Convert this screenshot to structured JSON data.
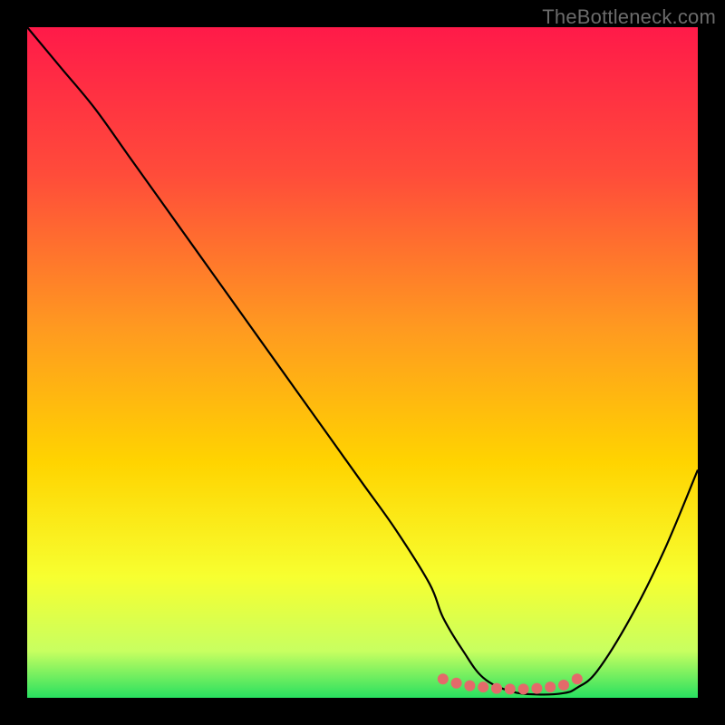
{
  "watermark": "TheBottleneck.com",
  "chart_data": {
    "type": "line",
    "title": "",
    "xlabel": "",
    "ylabel": "",
    "xlim": [
      0,
      100
    ],
    "ylim": [
      0,
      100
    ],
    "background_gradient": {
      "stops": [
        {
          "offset": 0.0,
          "color": "#ff1a49"
        },
        {
          "offset": 0.22,
          "color": "#ff4c3a"
        },
        {
          "offset": 0.45,
          "color": "#ff9a20"
        },
        {
          "offset": 0.65,
          "color": "#ffd400"
        },
        {
          "offset": 0.82,
          "color": "#f7ff30"
        },
        {
          "offset": 0.93,
          "color": "#c8ff60"
        },
        {
          "offset": 1.0,
          "color": "#28e060"
        }
      ]
    },
    "series": [
      {
        "name": "bottleneck-curve",
        "color": "#000000",
        "x": [
          0,
          5,
          10,
          15,
          20,
          25,
          30,
          35,
          40,
          45,
          50,
          55,
          60,
          62,
          65,
          68,
          72,
          76,
          80,
          82,
          85,
          90,
          95,
          100
        ],
        "values": [
          100,
          94,
          88,
          81,
          74,
          67,
          60,
          53,
          46,
          39,
          32,
          25,
          17,
          12,
          7,
          3,
          1,
          0.5,
          0.7,
          1.5,
          4,
          12,
          22,
          34
        ]
      }
    ],
    "markers": {
      "name": "optimal-range-dots",
      "color": "#e46a6a",
      "radius": 6,
      "points": [
        {
          "x": 62,
          "y": 2.8
        },
        {
          "x": 64,
          "y": 2.2
        },
        {
          "x": 66,
          "y": 1.8
        },
        {
          "x": 68,
          "y": 1.6
        },
        {
          "x": 70,
          "y": 1.4
        },
        {
          "x": 72,
          "y": 1.3
        },
        {
          "x": 74,
          "y": 1.3
        },
        {
          "x": 76,
          "y": 1.4
        },
        {
          "x": 78,
          "y": 1.6
        },
        {
          "x": 80,
          "y": 1.9
        },
        {
          "x": 82,
          "y": 2.8
        }
      ]
    }
  }
}
